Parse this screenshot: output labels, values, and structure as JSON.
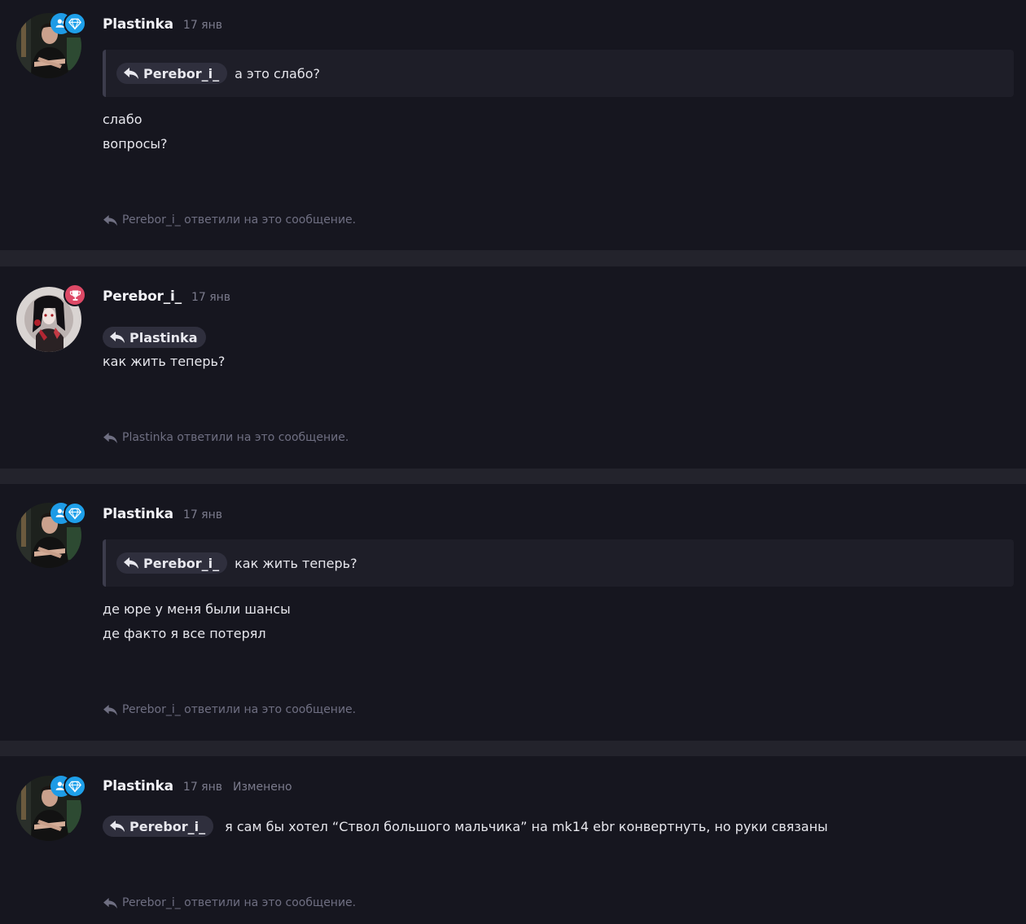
{
  "posts": [
    {
      "author": "Plastinka",
      "date": "17 янв",
      "quote": {
        "mention": "Perebor_i_",
        "text": "а это слабо?"
      },
      "lines": [
        "слабо",
        "вопросы?"
      ],
      "reply_note": "Perebor_i_ ответили на это сообщение."
    },
    {
      "author": "Perebor_i_",
      "date": "17 янв",
      "mention": "Plastinka",
      "lines": [
        "как жить теперь?"
      ],
      "reply_note": "Plastinka ответили на это сообщение."
    },
    {
      "author": "Plastinka",
      "date": "17 янв",
      "quote": {
        "mention": "Perebor_i_",
        "text": "как жить теперь?"
      },
      "lines": [
        "де юре у меня были шансы",
        "де факто я все потерял"
      ],
      "reply_note": "Perebor_i_ ответили на это сообщение."
    },
    {
      "author": "Plastinka",
      "date": "17 янв",
      "edited": "Изменено",
      "mention": "Perebor_i_",
      "inline_text": "я сам бы хотел “Ствол большого мальчика” на mk14 ebr конвертнуть, но руки связаны",
      "reply_note": "Perebor_i_ ответили на это сообщение."
    }
  ],
  "colors": {
    "page_bg": "#16161f",
    "separator": "#23232c",
    "quote_bg": "#1e1e28",
    "mention_bg": "#2f2f3d",
    "badge_blue": "#1e9be6",
    "badge_red": "#dd4966"
  },
  "icons": [
    "reply-arrow-icon",
    "diamond-icon",
    "user-group-icon",
    "trophy-icon"
  ]
}
